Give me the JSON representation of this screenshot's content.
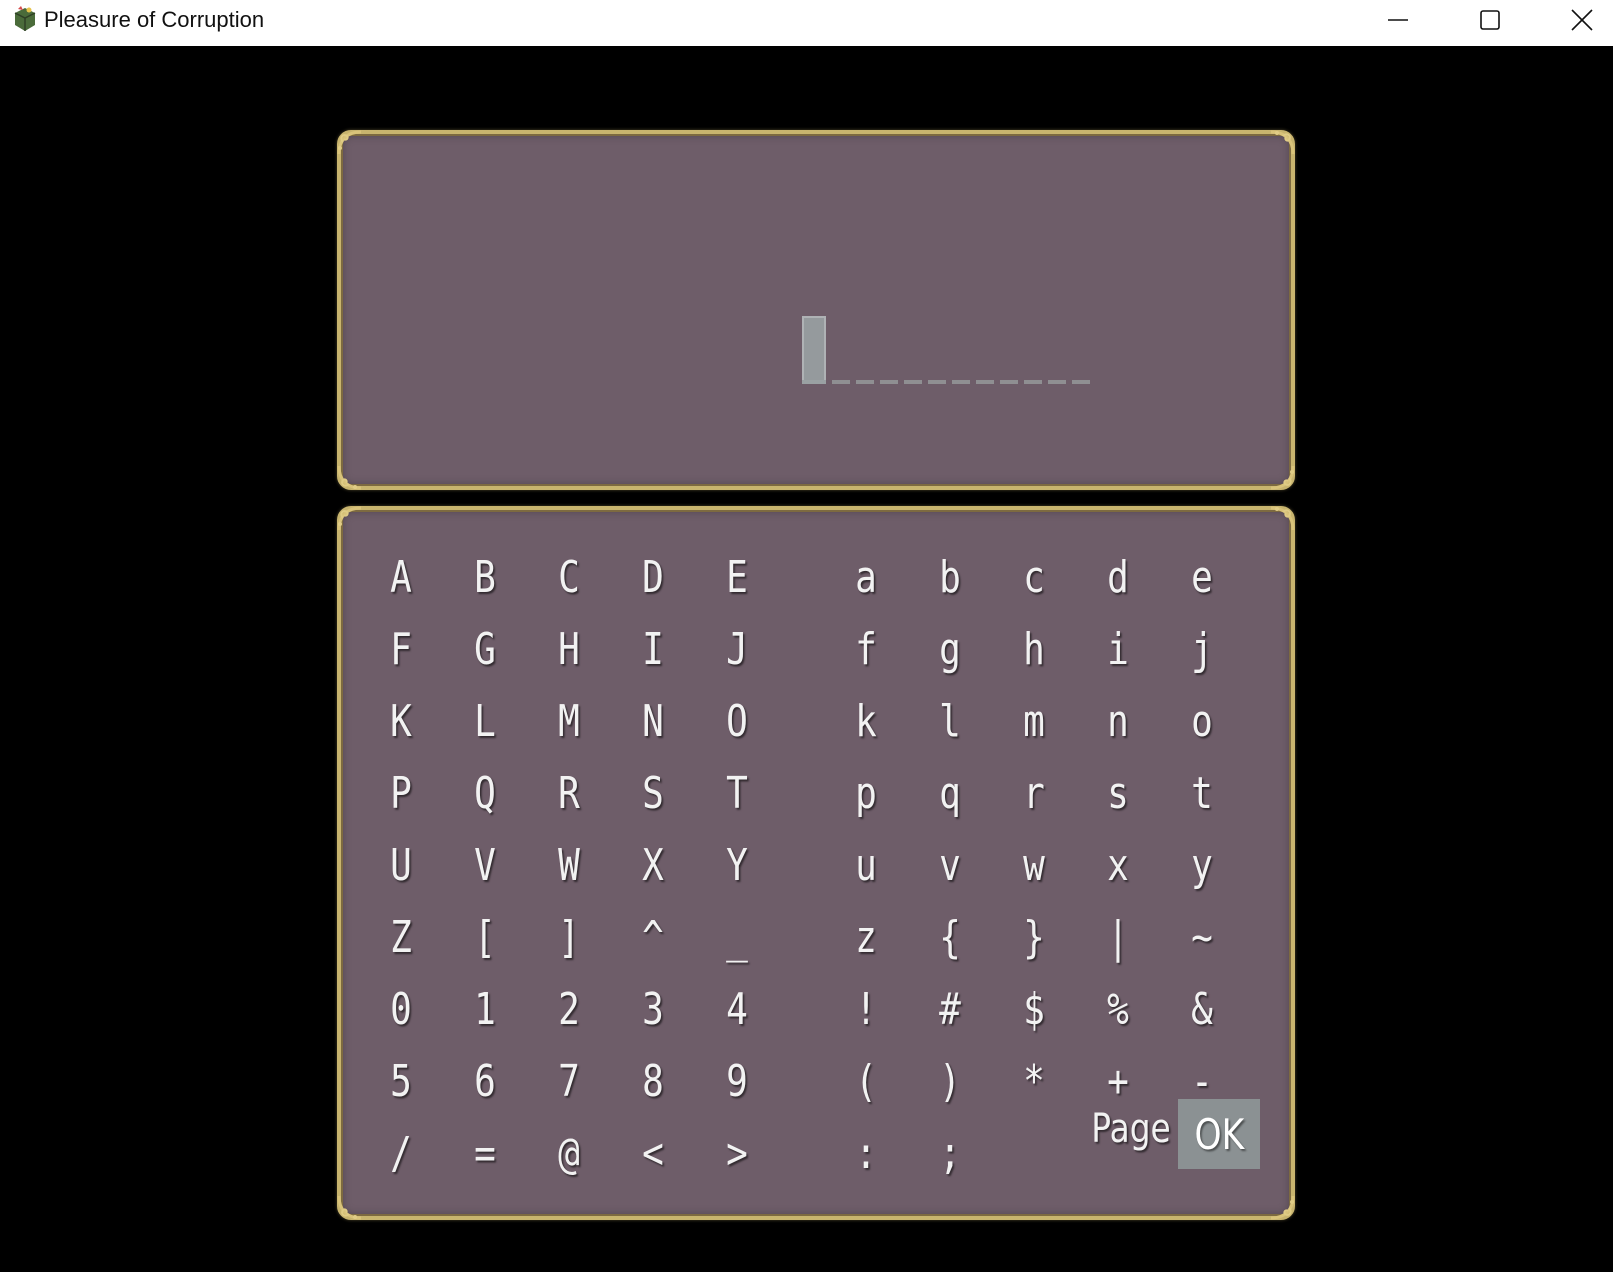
{
  "window": {
    "title": "Pleasure of Corruption",
    "minimize_label": "Minimize",
    "maximize_label": "Maximize",
    "close_label": "Close"
  },
  "name_entry": {
    "current_value": "",
    "max_length": 12
  },
  "keyboard": {
    "left_rows": [
      [
        "A",
        "B",
        "C",
        "D",
        "E"
      ],
      [
        "F",
        "G",
        "H",
        "I",
        "J"
      ],
      [
        "K",
        "L",
        "M",
        "N",
        "O"
      ],
      [
        "P",
        "Q",
        "R",
        "S",
        "T"
      ],
      [
        "U",
        "V",
        "W",
        "X",
        "Y"
      ],
      [
        "Z",
        "[",
        "]",
        "^",
        "_"
      ],
      [
        "0",
        "1",
        "2",
        "3",
        "4"
      ],
      [
        "5",
        "6",
        "7",
        "8",
        "9"
      ],
      [
        "/",
        "=",
        "@",
        "<",
        ">"
      ]
    ],
    "right_rows": [
      [
        "a",
        "b",
        "c",
        "d",
        "e"
      ],
      [
        "f",
        "g",
        "h",
        "i",
        "j"
      ],
      [
        "k",
        "l",
        "m",
        "n",
        "o"
      ],
      [
        "p",
        "q",
        "r",
        "s",
        "t"
      ],
      [
        "u",
        "v",
        "w",
        "x",
        "y"
      ],
      [
        "z",
        "{",
        "}",
        "|",
        "~"
      ],
      [
        "!",
        "#",
        "$",
        "%",
        "&"
      ],
      [
        "(",
        ")",
        "*",
        "+",
        "-"
      ],
      [
        ":",
        ";"
      ]
    ],
    "page_label": "Page",
    "ok_label": "OK",
    "selected": "OK"
  },
  "colors": {
    "panel_bg": "#6e5d69",
    "frame_gold": "#c8b46e",
    "highlight": "#8b9193"
  }
}
